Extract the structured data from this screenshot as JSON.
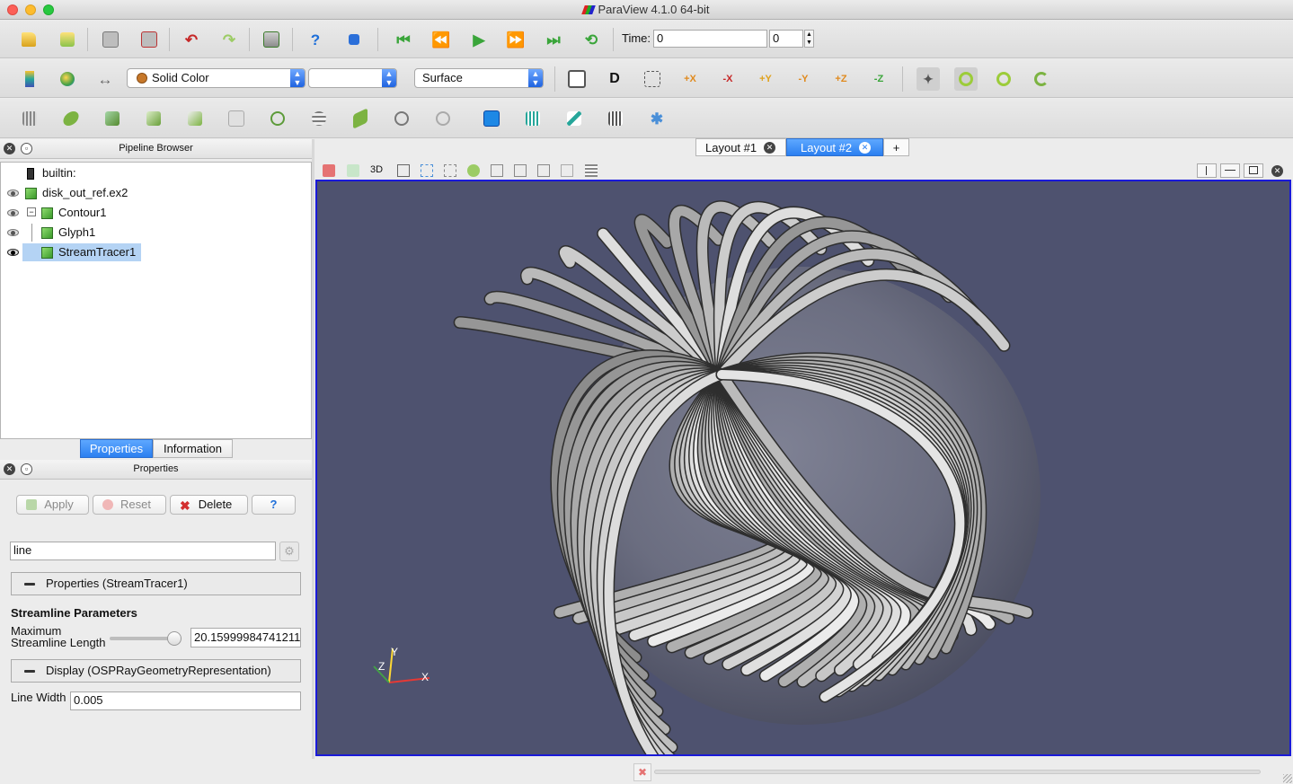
{
  "window": {
    "title": "ParaView 4.1.0 64-bit"
  },
  "time": {
    "label": "Time:",
    "value": "0",
    "step": "0"
  },
  "display": {
    "color_by": "Solid Color",
    "component": "",
    "representation": "Surface"
  },
  "pipeline": {
    "title": "Pipeline Browser",
    "items": [
      {
        "label": "builtin:"
      },
      {
        "label": "disk_out_ref.ex2"
      },
      {
        "label": "Contour1"
      },
      {
        "label": "Glyph1"
      },
      {
        "label": "StreamTracer1"
      }
    ]
  },
  "tabs": {
    "properties": "Properties",
    "information": "Information"
  },
  "properties": {
    "title": "Properties",
    "apply": "Apply",
    "reset": "Reset",
    "delete": "Delete",
    "help": "?",
    "search_value": "line",
    "section_props": "Properties (StreamTracer1)",
    "streamline_header": "Streamline Parameters",
    "max_len_label_1": "Maximum",
    "max_len_label_2": "Streamline Length",
    "max_len_value": "20.15999984741211",
    "max_len_fraction": 0.9,
    "section_display": "Display (OSPRayGeometryRepresentation)",
    "line_width_label": "Line Width",
    "line_width_value": "0.005"
  },
  "layouts": {
    "tab1": "Layout #1",
    "tab2": "Layout #2",
    "add": "+"
  },
  "view": {
    "mode": "3D",
    "axes": {
      "x": "X",
      "y": "Y",
      "z": "Z"
    },
    "background": "#4e526f"
  }
}
